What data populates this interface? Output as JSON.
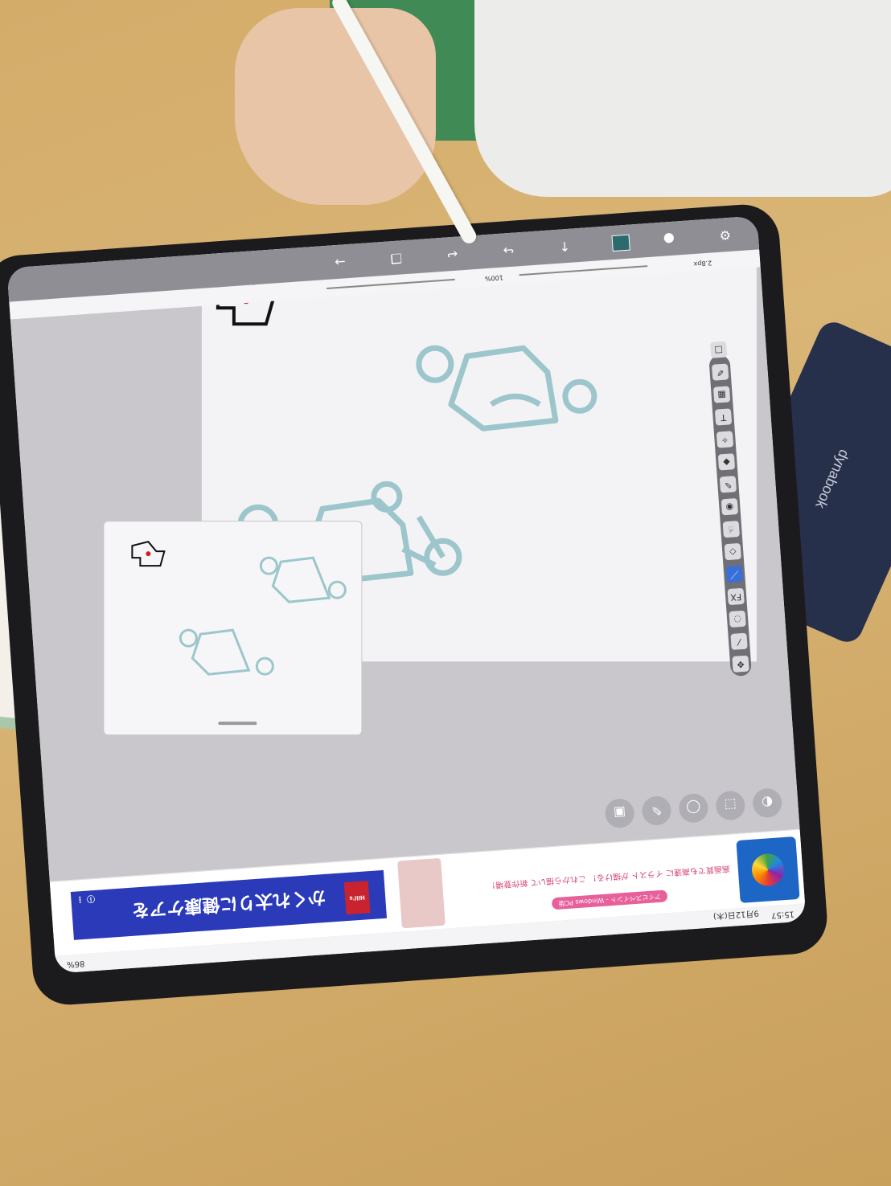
{
  "status_bar": {
    "time": "15:57",
    "date": "9月12日(木)",
    "battery": "86%"
  },
  "ad_banner": {
    "logo_icon": "ibis-paint-logo-icon",
    "tag": "アイビスペイント - Windows PC版",
    "line": "高画質でも高速に イラスト が描ける！ これから描いて 新作登場！",
    "right_text": "かくれ太りに健康ケアを",
    "right_brand": "Hill's",
    "info_icon": "info-icon",
    "more_icon": "more-vertical-icon"
  },
  "bottom_tools": [
    {
      "name": "layer-settings-icon",
      "glyph": "◐"
    },
    {
      "name": "selection-icon",
      "glyph": "⬚"
    },
    {
      "name": "lasso-icon",
      "glyph": "◯"
    },
    {
      "name": "edit-icon",
      "glyph": "✎"
    },
    {
      "name": "gallery-icon",
      "glyph": "▣"
    }
  ],
  "side_tools": [
    {
      "name": "move-icon",
      "glyph": "✥",
      "label": "移動変形"
    },
    {
      "name": "brush-icon",
      "glyph": "⁄",
      "label": "自動選択"
    },
    {
      "name": "lasso-tool-icon",
      "glyph": "◌",
      "label": "投げ縄"
    },
    {
      "name": "filter-icon",
      "glyph": "FX",
      "label": "フィルター"
    },
    {
      "name": "pen-icon",
      "glyph": "／",
      "label": "ブラシ"
    },
    {
      "name": "eraser-icon",
      "glyph": "◇",
      "label": "消しゴム"
    },
    {
      "name": "smudge-icon",
      "glyph": "☝",
      "label": "指先"
    },
    {
      "name": "blur-icon",
      "glyph": "◉",
      "label": "ぼかし"
    },
    {
      "name": "eyedropper-icon",
      "glyph": "✎",
      "label": "スポイト"
    },
    {
      "name": "fill-icon",
      "glyph": "◆",
      "label": "塗りつぶし"
    },
    {
      "name": "magic-wand-icon",
      "glyph": "✧",
      "label": "ビットマップ"
    },
    {
      "name": "text-icon",
      "glyph": "T",
      "label": "テキスト"
    },
    {
      "name": "frame-icon",
      "glyph": "▦",
      "label": "コマ割り"
    },
    {
      "name": "ruler-icon",
      "glyph": "✐",
      "label": "定規"
    },
    {
      "name": "canvas-icon",
      "glyph": "□",
      "label": "キャンバス"
    }
  ],
  "top_toolbar": [
    {
      "name": "settings-icon",
      "glyph": "⚙"
    },
    {
      "name": "color-wheel-icon",
      "glyph": "●"
    },
    {
      "name": "color-swatch",
      "glyph": ""
    },
    {
      "name": "export-icon",
      "glyph": "↑"
    },
    {
      "name": "redo-icon",
      "glyph": "↪"
    },
    {
      "name": "undo-icon",
      "glyph": "↩"
    },
    {
      "name": "layer-icon",
      "glyph": "❐"
    },
    {
      "name": "back-icon",
      "glyph": "→"
    }
  ],
  "sliders": {
    "brush_size": "2.8px",
    "opacity": "100%"
  },
  "colors": {
    "accent": "#2d6a6d",
    "stroke": "#9cc6cb",
    "status_bg": "#f4f4f6",
    "toolbar_bg": "#8f8e95"
  }
}
